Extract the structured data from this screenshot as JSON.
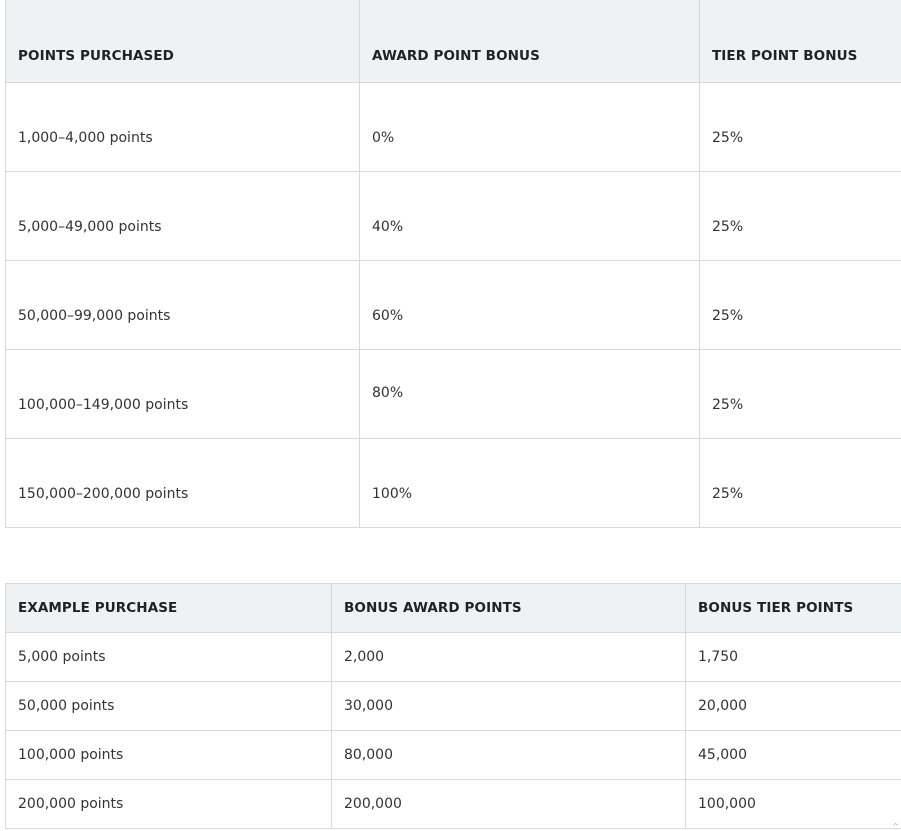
{
  "purchase_table": {
    "headers": [
      "POINTS PURCHASED",
      "AWARD POINT BONUS",
      "TIER POINT BONUS"
    ],
    "rows": [
      {
        "points": "1,000–4,000 points",
        "award": "0%",
        "tier": "25%"
      },
      {
        "points": "5,000–49,000 points",
        "award": "40%",
        "tier": "25%"
      },
      {
        "points": "50,000–99,000 points",
        "award": "60%",
        "tier": "25%"
      },
      {
        "points": "100,000–149,000 points",
        "award": "80%",
        "tier": "25%"
      },
      {
        "points": "150,000–200,000 points",
        "award": "100%",
        "tier": "25%"
      }
    ]
  },
  "example_table": {
    "headers": [
      "EXAMPLE PURCHASE",
      "BONUS AWARD POINTS",
      "BONUS TIER POINTS"
    ],
    "rows": [
      {
        "purchase": "5,000 points",
        "award": "2,000",
        "tier": "1,750"
      },
      {
        "purchase": "50,000 points",
        "award": "30,000",
        "tier": "20,000"
      },
      {
        "purchase": "100,000 points",
        "award": "80,000",
        "tier": "45,000"
      },
      {
        "purchase": "200,000 points",
        "award": "200,000",
        "tier": "100,000"
      }
    ]
  },
  "scroll_indicator": {
    "glyph": "^"
  }
}
